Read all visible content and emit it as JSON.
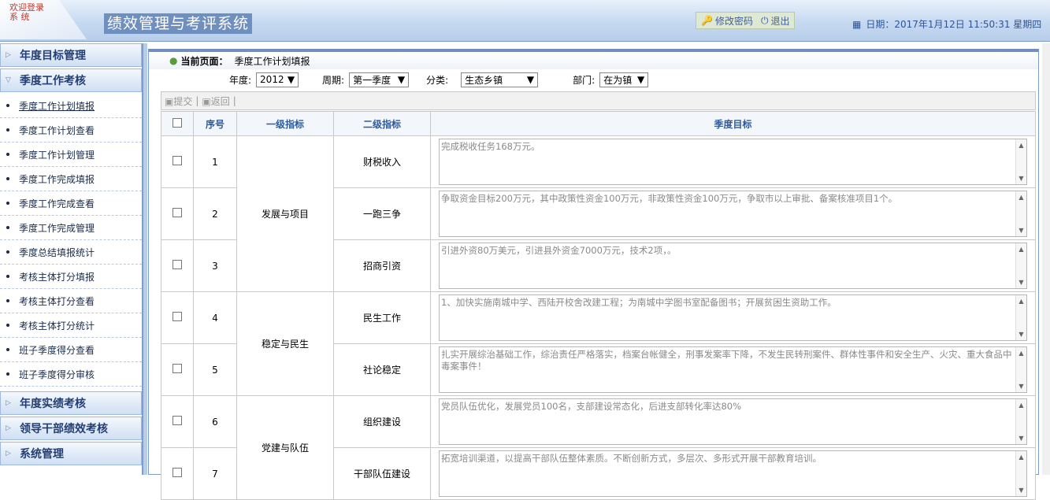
{
  "header": {
    "welcome": "欢迎登录 系 统",
    "title": "绩效管理与考评系统",
    "change_password": "修改密码",
    "logout": "退出",
    "date": "日期：2017年1月12日 11:50:31 星期四"
  },
  "sidebar": {
    "sections": [
      "年度目标管理",
      "季度工作考核",
      "年度实绩考核",
      "领导干部绩效考核",
      "系统管理"
    ],
    "items": [
      "季度工作计划填报",
      "季度工作计划查看",
      "季度工作计划管理",
      "季度工作完成填报",
      "季度工作完成查看",
      "季度工作完成管理",
      "季度总结填报统计",
      "考核主体打分填报",
      "考核主体打分查看",
      "考核主体打分统计",
      "班子季度得分查看",
      "班子季度得分审核"
    ]
  },
  "breadcrumb": {
    "label": "当前页面：",
    "current": "季度工作计划填报"
  },
  "filters": {
    "year_label": "年度:",
    "year": "2012",
    "period_label": "周期:",
    "period": "第一季度",
    "category_label": "分类:",
    "category": "生态乡镇",
    "dept_label": "部门:",
    "dept": "在为镇"
  },
  "toolbar": {
    "submit": "提交",
    "back": "返回"
  },
  "table": {
    "headers": [
      "序号",
      "一级指标",
      "二级指标",
      "季度目标"
    ],
    "rows": [
      {
        "no": "1",
        "level1": "发展与项目",
        "level2": "财税收入",
        "target": "完成税收任务168万元。"
      },
      {
        "no": "2",
        "level2": "一跑三争",
        "target": "争取资金目标200万元，其中政策性资金100万元，非政策性资金100万元，争取市以上审批、备案核准项目1个。"
      },
      {
        "no": "3",
        "level2": "招商引资",
        "target": "引进外资80万美元，引进县外资金7000万元，技术2项，。"
      },
      {
        "no": "4",
        "level1": "稳定与民生",
        "level2": "民生工作",
        "target": "1、加快实施南城中学、西陆开校舍改建工程；为南城中学图书室配备图书；开展贫困生资助工作。"
      },
      {
        "no": "5",
        "level2": "社论稳定",
        "target": "扎实开展综治基础工作，综治责任严格落实，档案台帐健全，刑事发案率下降，不发生民转刑案件、群体性事件和安全生产、火灾、重大食品中毒案事件！"
      },
      {
        "no": "6",
        "level1": "党建与队伍",
        "level2": "组织建设",
        "target": "党员队伍优化，发展党员100名，支部建设常态化，后进支部转化率达80%"
      },
      {
        "no": "7",
        "level2": "干部队伍建设",
        "target": "拓宽培训渠道，以提高干部队伍整体素质。不断创新方式，多层次、多形式开展干部教育培训。"
      }
    ]
  }
}
